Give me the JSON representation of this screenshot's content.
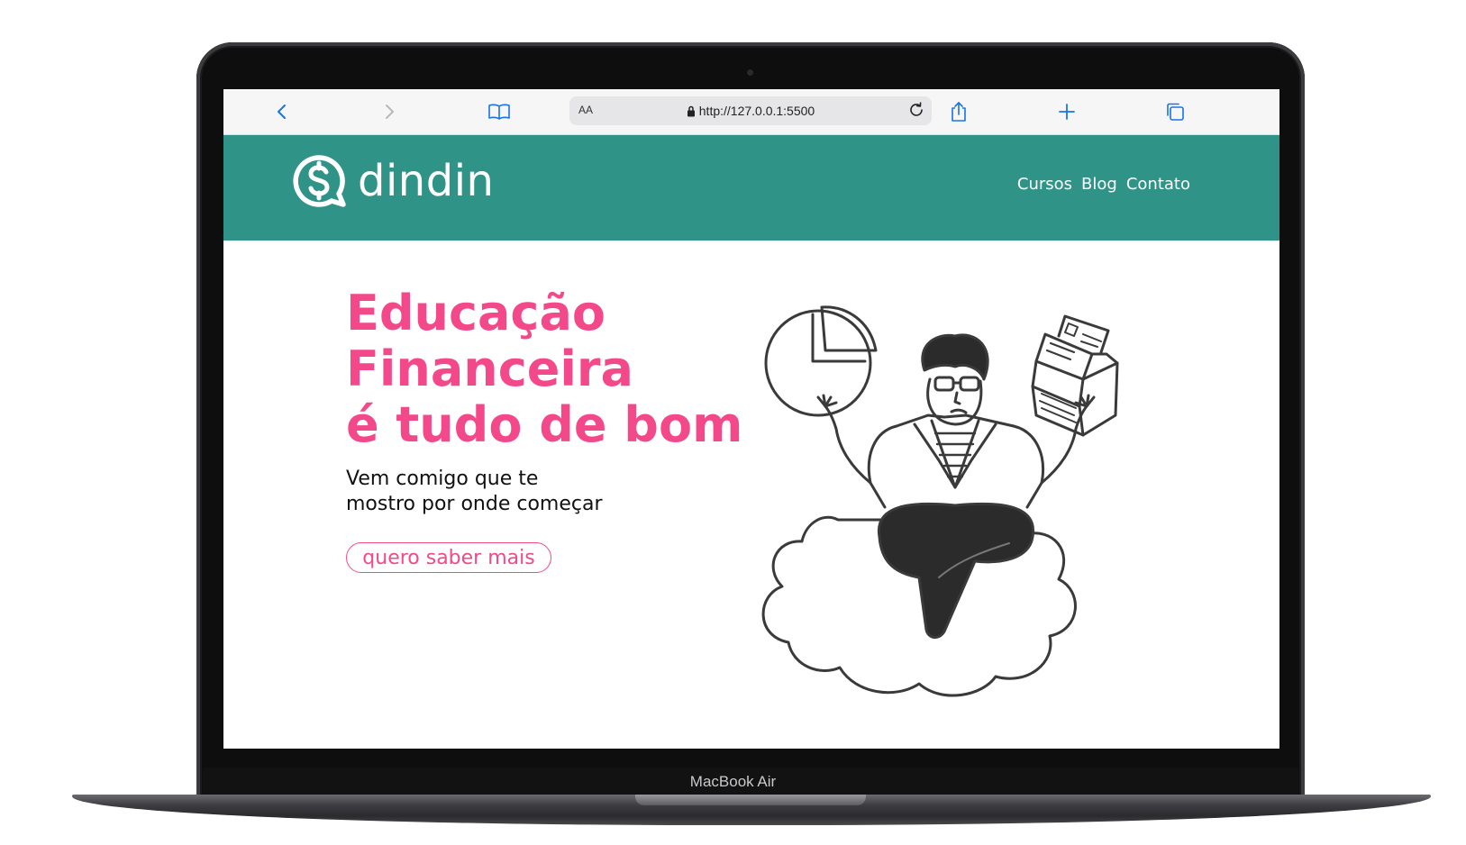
{
  "device": {
    "label": "MacBook Air"
  },
  "browser": {
    "text_size_label": "AA",
    "url": "http://127.0.0.1:5500",
    "icons": [
      "back-icon",
      "forward-icon",
      "bookmarks-icon",
      "lock-icon",
      "reload-icon",
      "share-icon",
      "new-tab-icon",
      "tabs-icon"
    ]
  },
  "site": {
    "brand": "dindin",
    "nav": [
      "Cursos",
      "Blog",
      "Contato"
    ],
    "hero": {
      "title_lines": [
        "Educação",
        "Financeira",
        "é tudo de bom"
      ],
      "subtitle_lines": [
        "Vem comigo que te",
        "mostro por onde começar"
      ],
      "cta_label": "quero saber mais"
    },
    "colors": {
      "header_bg": "#309388",
      "accent": "#f3498a",
      "text": "#111111"
    }
  }
}
